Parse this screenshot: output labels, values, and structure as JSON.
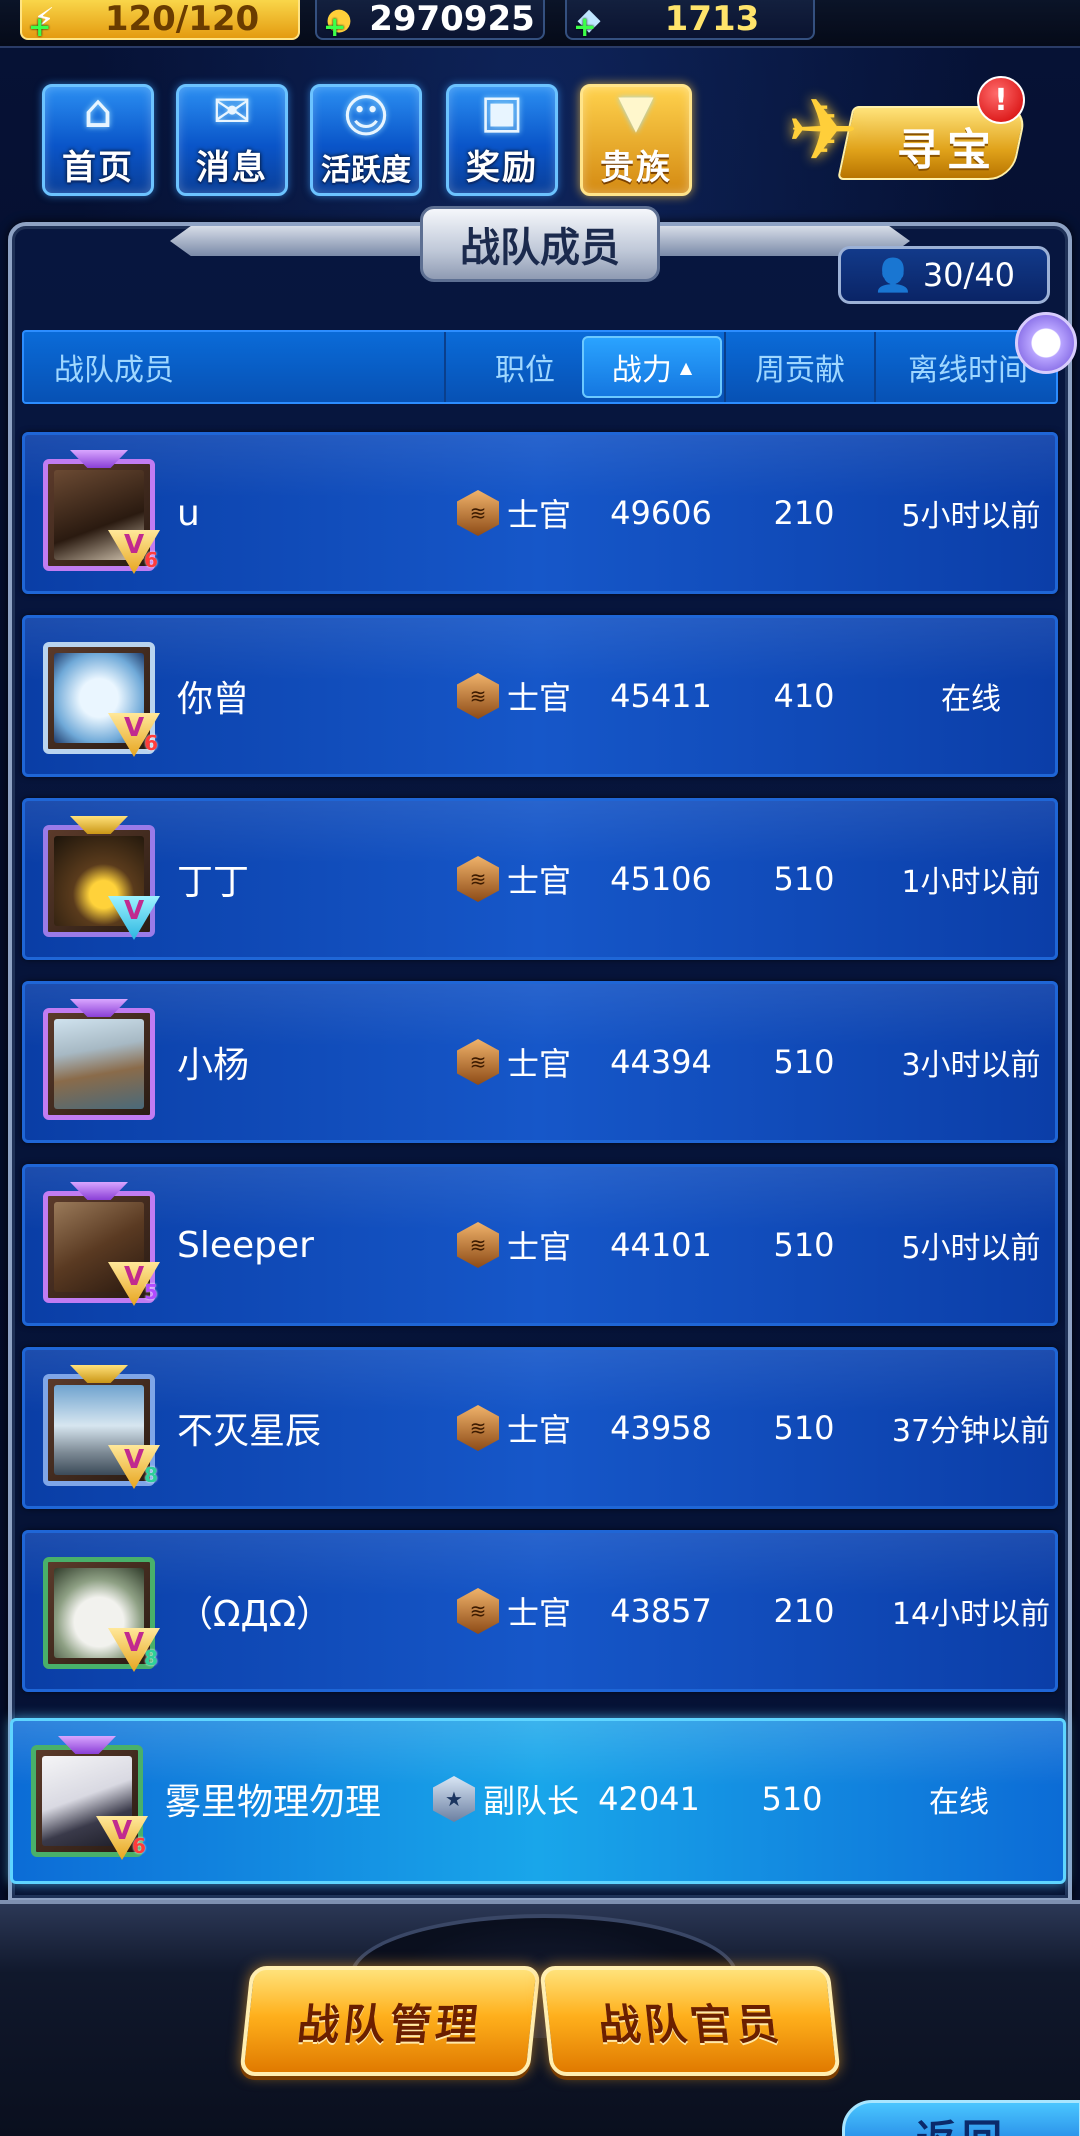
{
  "resources": {
    "energy": "120/120",
    "gold": "2970925",
    "gems": "1713"
  },
  "nav": [
    {
      "label": "首页",
      "icon": "home-icon"
    },
    {
      "label": "消息",
      "icon": "mail-icon"
    },
    {
      "label": "活跃度",
      "icon": "smiley-wings-icon"
    },
    {
      "label": "奖励",
      "icon": "gift-icon"
    },
    {
      "label": "贵族",
      "icon": "noble-badge-icon"
    }
  ],
  "treasure": {
    "label": "寻宝",
    "alert": "!"
  },
  "panel": {
    "title": "战队成员",
    "member_count": "30/40"
  },
  "columns": {
    "name": "战队成员",
    "position": "职位",
    "power": "战力",
    "weekly": "周贡献",
    "offline": "离线时间",
    "sort_indicator": "▲"
  },
  "members": [
    {
      "name": "u",
      "rank": "士官",
      "power": "49606",
      "weekly": "210",
      "offline": "5小时以前",
      "vip": "6"
    },
    {
      "name": "你曾",
      "rank": "士官",
      "power": "45411",
      "weekly": "410",
      "offline": "在线",
      "vip": "6"
    },
    {
      "name": "丁丁",
      "rank": "士官",
      "power": "45106",
      "weekly": "510",
      "offline": "1小时以前",
      "vip": ""
    },
    {
      "name": "小杨",
      "rank": "士官",
      "power": "44394",
      "weekly": "510",
      "offline": "3小时以前",
      "vip": ""
    },
    {
      "name": "Sleeper",
      "rank": "士官",
      "power": "44101",
      "weekly": "510",
      "offline": "5小时以前",
      "vip": "5"
    },
    {
      "name": "不灭星辰",
      "rank": "士官",
      "power": "43958",
      "weekly": "510",
      "offline": "37分钟以前",
      "vip": "8"
    },
    {
      "name": "（ΩДΩ）",
      "rank": "士官",
      "power": "43857",
      "weekly": "210",
      "offline": "14小时以前",
      "vip": "8"
    },
    {
      "name": "雾里物理勿理",
      "rank": "副队长",
      "power": "42041",
      "weekly": "510",
      "offline": "在线",
      "vip": "6"
    }
  ],
  "buttons": {
    "manage": "战队管理",
    "officers": "战队官员",
    "return": "返回"
  },
  "colors": {
    "accent": "#1657c9",
    "highlight": "#19a6ea",
    "gold": "#ffb01c"
  }
}
